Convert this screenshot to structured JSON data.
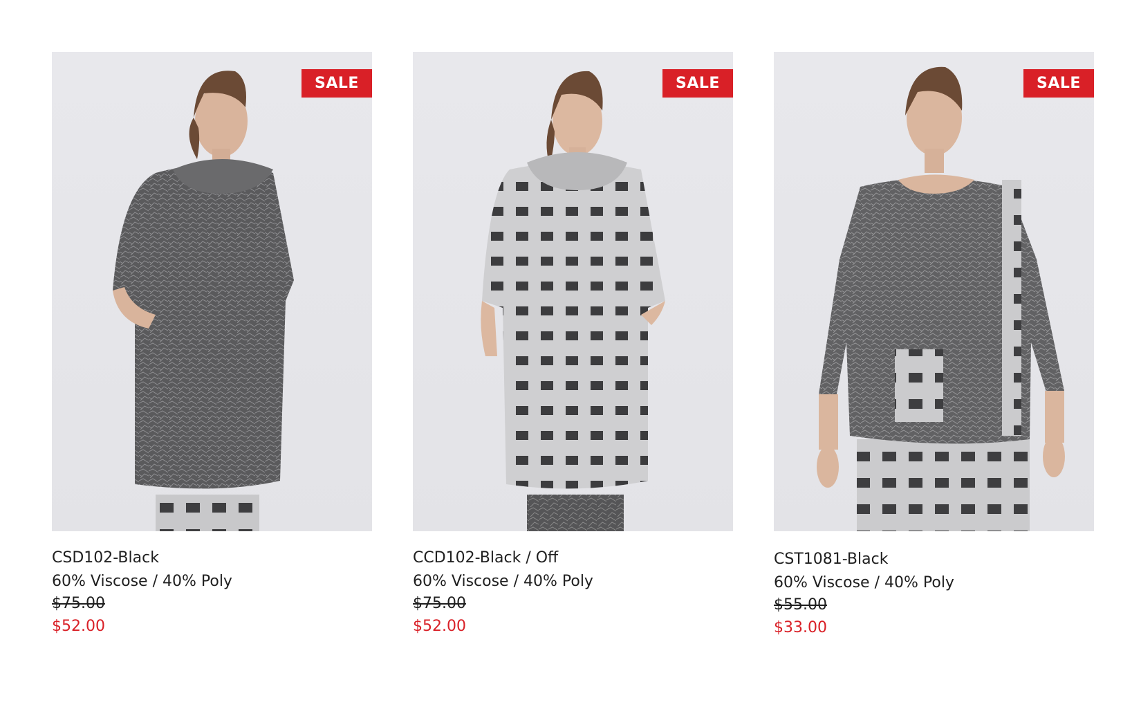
{
  "products": [
    {
      "badge": "SALE",
      "name": "CSD102-Black",
      "material": "60% Viscose / 40% Poly",
      "old_price": "$75.00",
      "new_price": "$52.00"
    },
    {
      "badge": "SALE",
      "name": "CCD102-Black / Off",
      "material": "60% Viscose / 40% Poly",
      "old_price": "$75.00",
      "new_price": "$52.00"
    },
    {
      "badge": "SALE",
      "name": "CST1081-Black",
      "material": "60% Viscose / 40% Poly",
      "old_price": "$55.00",
      "new_price": "$33.00"
    }
  ],
  "colors": {
    "sale_red": "#d92027",
    "text": "#1f1f1f",
    "photo_bg": "#e6e6ea"
  }
}
